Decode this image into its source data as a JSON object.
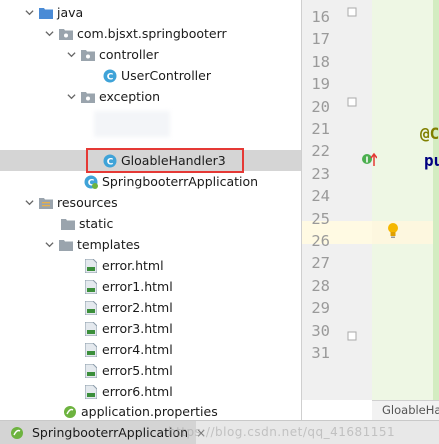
{
  "tree": {
    "java": "java",
    "package": "com.bjsxt.springbooterr",
    "controller": "controller",
    "user_controller": "UserController",
    "exception": "exception",
    "gloable_handler": "GloableHandler3",
    "app_class": "SpringbooterrApplication",
    "resources": "resources",
    "static": "static",
    "templates": "templates",
    "templates_files": [
      "error.html",
      "error1.html",
      "error2.html",
      "error3.html",
      "error4.html",
      "error5.html",
      "error6.html"
    ],
    "app_properties": "application.properties"
  },
  "editor": {
    "line_numbers": [
      "16",
      "17",
      "18",
      "19",
      "20",
      "21",
      "22",
      "23",
      "24",
      "25",
      "26",
      "27",
      "28",
      "29",
      "30",
      "31"
    ],
    "code_fragment_21": "@C",
    "code_fragment_22": "pu",
    "tab_title": "GloableHa"
  },
  "bottom": {
    "run_tab_label": "SpringbooterrApplication",
    "close_glyph": "×",
    "watermark": "https://blog.csdn.net/qq_41681151"
  },
  "colors": {
    "selection": "#d5d5d5",
    "highlight_box": "#e53935",
    "gutter": "#f0f0f0",
    "code_bg": "#eef7e4"
  }
}
